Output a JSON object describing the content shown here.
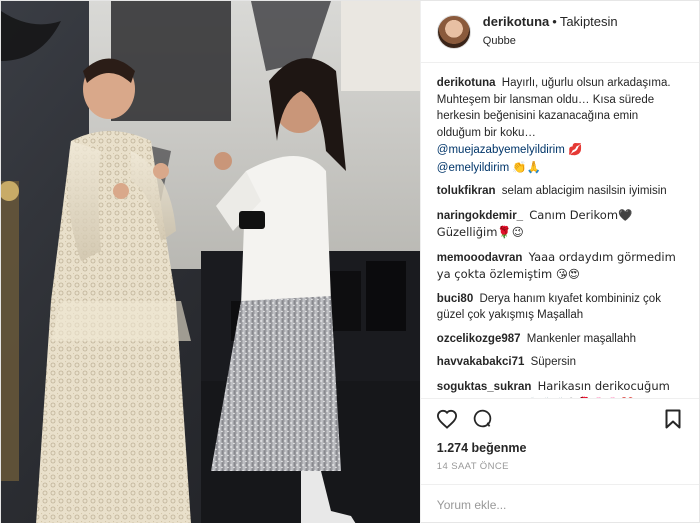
{
  "header": {
    "username": "derikotuna",
    "separator": "•",
    "follow_status": "Takiptesin",
    "location": "Qubbe"
  },
  "caption": {
    "user": "derikotuna",
    "text": "Hayırlı, uğurlu olsun arkadaşıma. Muhteşem bir lansman oldu… Kısa sürede herkesin beğenisini kazanacağına emin olduğum bir koku…",
    "mention1": "@muejazabyemelyildirim",
    "mention1_emoji": "💋",
    "mention2": "@emelyildirim",
    "mention2_emoji": "👏🙏"
  },
  "comments": [
    {
      "user": "tolukfikran",
      "text": "selam ablacigim nasilsin iyimisin"
    },
    {
      "user": "naringokdemir_",
      "text": "Canım Derikom🖤 Güzelliğim🌹😉"
    },
    {
      "user": "memooodavran",
      "text": "Yaaa ordaydım görmedim ya çokta özlemiştim 😘😍"
    },
    {
      "user": "buci80",
      "text": "Derya hanım kıyafet kombininiz çok güzel çok yakışmış Maşallah"
    },
    {
      "user": "ozcelikozge987",
      "text": "Mankenler maşallahh"
    },
    {
      "user": "havvakabakci71",
      "text": "Süpersin"
    },
    {
      "user": "soguktas_sukran",
      "text": "Harikasın derikocuğum Maşallah sana 👏👏👏😘🌹🌸🌸💔"
    }
  ],
  "likes_text": "1.274 beğenme",
  "timestamp": "14 SAAT ÖNCE",
  "comment_input": {
    "placeholder": "Yorum ekle..."
  },
  "icons": {
    "like": "heart-icon",
    "comment": "comment-icon",
    "save": "bookmark-icon"
  },
  "colors": {
    "mention": "#003569",
    "text": "#262626",
    "muted": "#999999"
  }
}
